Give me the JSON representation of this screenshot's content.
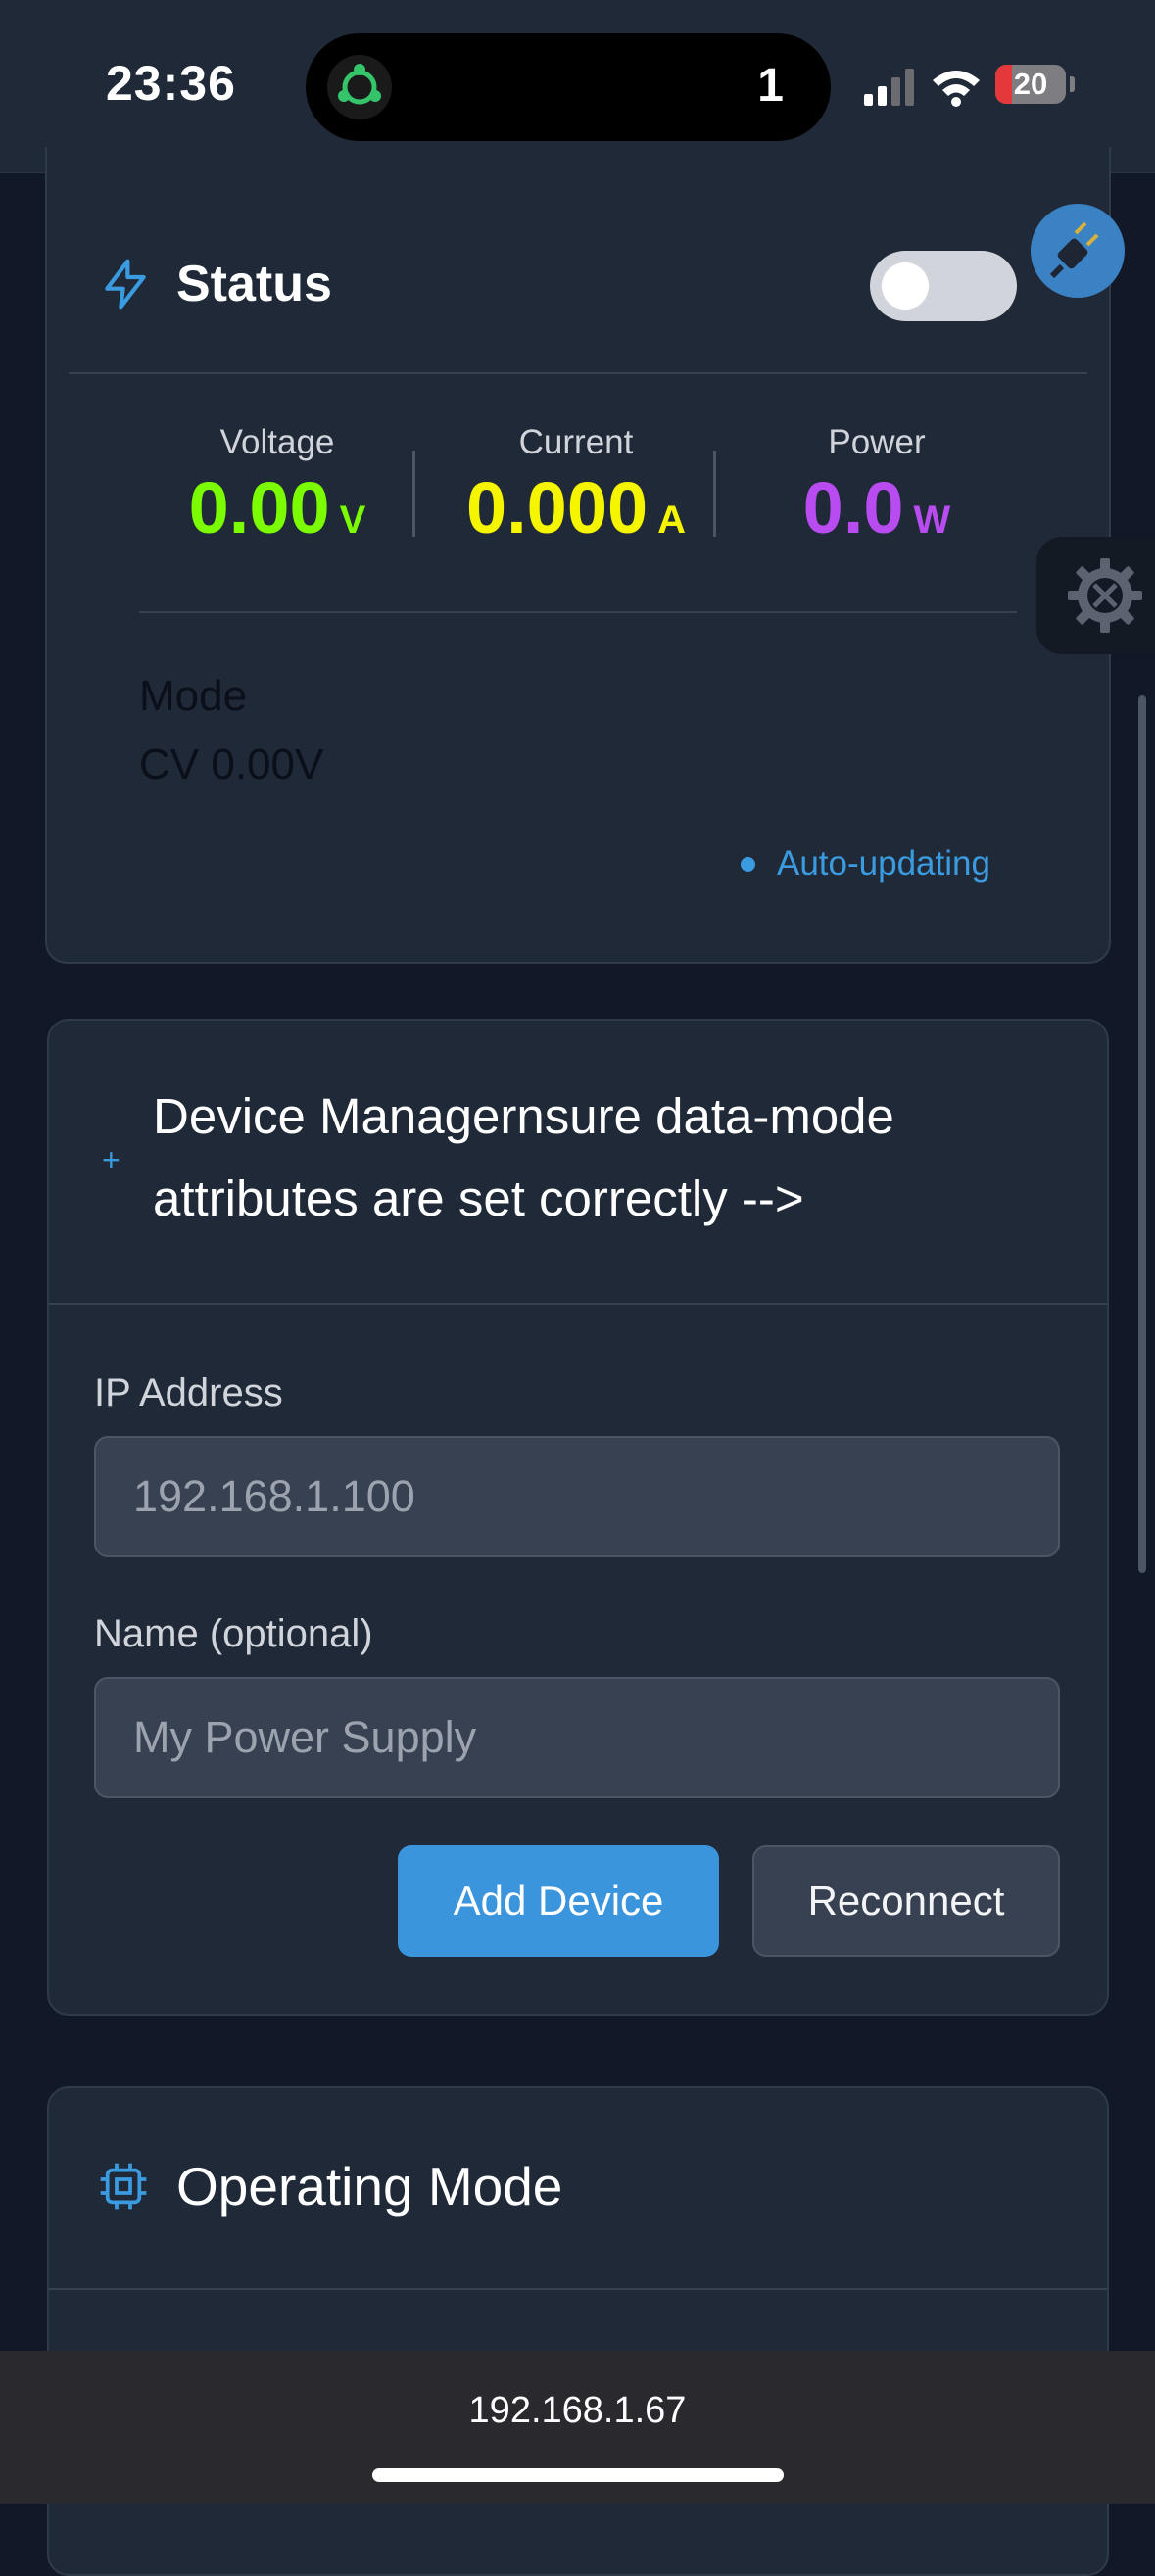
{
  "status_bar": {
    "time": "23:36",
    "island_count": "1",
    "battery": "20",
    "battery_level": 0.2
  },
  "status_card": {
    "title": "Status",
    "power_toggle_on": false,
    "metrics": [
      {
        "label": "Voltage",
        "value": "0.00",
        "unit": "V",
        "color": "#7cfc00"
      },
      {
        "label": "Current",
        "value": "0.000",
        "unit": "A",
        "color": "#f5f500"
      },
      {
        "label": "Power",
        "value": "0.0",
        "unit": "W",
        "color": "#b84cf0"
      }
    ],
    "mode_label": "Mode",
    "mode_value": "CV 0.00V",
    "auto_updating": "Auto-updating"
  },
  "device_manager": {
    "icon": "+",
    "title": "Device Managernsure data-mode attributes are set correctly -->",
    "ip_label": "IP Address",
    "ip_placeholder": "192.168.1.100",
    "name_label": "Name (optional)",
    "name_placeholder": "My Power Supply",
    "add_button": "Add Device",
    "reconnect_button": "Reconnect"
  },
  "operating_mode": {
    "title": "Operating Mode"
  },
  "browser": {
    "url": "192.168.1.67"
  },
  "colors": {
    "accent": "#3a95dc",
    "background": "#111827",
    "card": "#1f2937"
  }
}
